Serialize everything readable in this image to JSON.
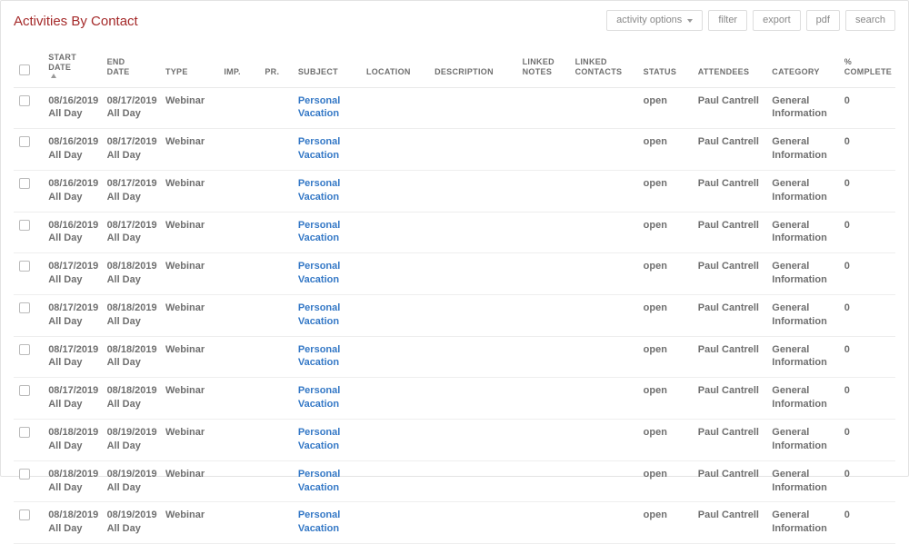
{
  "title": "Activities By Contact",
  "toolbar": {
    "options_label": "activity options",
    "filter_label": "filter",
    "export_label": "export",
    "pdf_label": "pdf",
    "search_label": "search"
  },
  "columns": {
    "checkbox": "",
    "start_l1": "START",
    "start_l2": "DATE",
    "end_l1": "END",
    "end_l2": "DATE",
    "type": "TYPE",
    "imp": "IMP.",
    "pr": "PR.",
    "subject": "SUBJECT",
    "location": "LOCATION",
    "description": "DESCRIPTION",
    "linked_notes_l1": "LINKED",
    "linked_notes_l2": "NOTES",
    "linked_contacts_l1": "LINKED",
    "linked_contacts_l2": "CONTACTS",
    "status": "STATUS",
    "attendees": "ATTENDEES",
    "category": "CATEGORY",
    "complete_l1": "%",
    "complete_l2": "COMPLETE"
  },
  "rows": [
    {
      "start_date": "08/16/2019",
      "start_time": "All Day",
      "end_date": "08/17/2019",
      "end_time": "All Day",
      "type": "Webinar",
      "imp": "",
      "pr": "",
      "subject_l1": "Personal",
      "subject_l2": "Vacation",
      "location": "",
      "description": "",
      "linked_notes": "",
      "linked_contacts": "",
      "status": "open",
      "attendees": "Paul Cantrell",
      "category_l1": "General",
      "category_l2": "Information",
      "complete": "0"
    },
    {
      "start_date": "08/16/2019",
      "start_time": "All Day",
      "end_date": "08/17/2019",
      "end_time": "All Day",
      "type": "Webinar",
      "imp": "",
      "pr": "",
      "subject_l1": "Personal",
      "subject_l2": "Vacation",
      "location": "",
      "description": "",
      "linked_notes": "",
      "linked_contacts": "",
      "status": "open",
      "attendees": "Paul Cantrell",
      "category_l1": "General",
      "category_l2": "Information",
      "complete": "0"
    },
    {
      "start_date": "08/16/2019",
      "start_time": "All Day",
      "end_date": "08/17/2019",
      "end_time": "All Day",
      "type": "Webinar",
      "imp": "",
      "pr": "",
      "subject_l1": "Personal",
      "subject_l2": "Vacation",
      "location": "",
      "description": "",
      "linked_notes": "",
      "linked_contacts": "",
      "status": "open",
      "attendees": "Paul Cantrell",
      "category_l1": "General",
      "category_l2": "Information",
      "complete": "0"
    },
    {
      "start_date": "08/16/2019",
      "start_time": "All Day",
      "end_date": "08/17/2019",
      "end_time": "All Day",
      "type": "Webinar",
      "imp": "",
      "pr": "",
      "subject_l1": "Personal",
      "subject_l2": "Vacation",
      "location": "",
      "description": "",
      "linked_notes": "",
      "linked_contacts": "",
      "status": "open",
      "attendees": "Paul Cantrell",
      "category_l1": "General",
      "category_l2": "Information",
      "complete": "0"
    },
    {
      "start_date": "08/17/2019",
      "start_time": "All Day",
      "end_date": "08/18/2019",
      "end_time": "All Day",
      "type": "Webinar",
      "imp": "",
      "pr": "",
      "subject_l1": "Personal",
      "subject_l2": "Vacation",
      "location": "",
      "description": "",
      "linked_notes": "",
      "linked_contacts": "",
      "status": "open",
      "attendees": "Paul Cantrell",
      "category_l1": "General",
      "category_l2": "Information",
      "complete": "0"
    },
    {
      "start_date": "08/17/2019",
      "start_time": "All Day",
      "end_date": "08/18/2019",
      "end_time": "All Day",
      "type": "Webinar",
      "imp": "",
      "pr": "",
      "subject_l1": "Personal",
      "subject_l2": "Vacation",
      "location": "",
      "description": "",
      "linked_notes": "",
      "linked_contacts": "",
      "status": "open",
      "attendees": "Paul Cantrell",
      "category_l1": "General",
      "category_l2": "Information",
      "complete": "0"
    },
    {
      "start_date": "08/17/2019",
      "start_time": "All Day",
      "end_date": "08/18/2019",
      "end_time": "All Day",
      "type": "Webinar",
      "imp": "",
      "pr": "",
      "subject_l1": "Personal",
      "subject_l2": "Vacation",
      "location": "",
      "description": "",
      "linked_notes": "",
      "linked_contacts": "",
      "status": "open",
      "attendees": "Paul Cantrell",
      "category_l1": "General",
      "category_l2": "Information",
      "complete": "0"
    },
    {
      "start_date": "08/17/2019",
      "start_time": "All Day",
      "end_date": "08/18/2019",
      "end_time": "All Day",
      "type": "Webinar",
      "imp": "",
      "pr": "",
      "subject_l1": "Personal",
      "subject_l2": "Vacation",
      "location": "",
      "description": "",
      "linked_notes": "",
      "linked_contacts": "",
      "status": "open",
      "attendees": "Paul Cantrell",
      "category_l1": "General",
      "category_l2": "Information",
      "complete": "0"
    },
    {
      "start_date": "08/18/2019",
      "start_time": "All Day",
      "end_date": "08/19/2019",
      "end_time": "All Day",
      "type": "Webinar",
      "imp": "",
      "pr": "",
      "subject_l1": "Personal",
      "subject_l2": "Vacation",
      "location": "",
      "description": "",
      "linked_notes": "",
      "linked_contacts": "",
      "status": "open",
      "attendees": "Paul Cantrell",
      "category_l1": "General",
      "category_l2": "Information",
      "complete": "0"
    },
    {
      "start_date": "08/18/2019",
      "start_time": "All Day",
      "end_date": "08/19/2019",
      "end_time": "All Day",
      "type": "Webinar",
      "imp": "",
      "pr": "",
      "subject_l1": "Personal",
      "subject_l2": "Vacation",
      "location": "",
      "description": "",
      "linked_notes": "",
      "linked_contacts": "",
      "status": "open",
      "attendees": "Paul Cantrell",
      "category_l1": "General",
      "category_l2": "Information",
      "complete": "0"
    },
    {
      "start_date": "08/18/2019",
      "start_time": "All Day",
      "end_date": "08/19/2019",
      "end_time": "All Day",
      "type": "Webinar",
      "imp": "",
      "pr": "",
      "subject_l1": "Personal",
      "subject_l2": "Vacation",
      "location": "",
      "description": "",
      "linked_notes": "",
      "linked_contacts": "",
      "status": "open",
      "attendees": "Paul Cantrell",
      "category_l1": "General",
      "category_l2": "Information",
      "complete": "0"
    }
  ]
}
